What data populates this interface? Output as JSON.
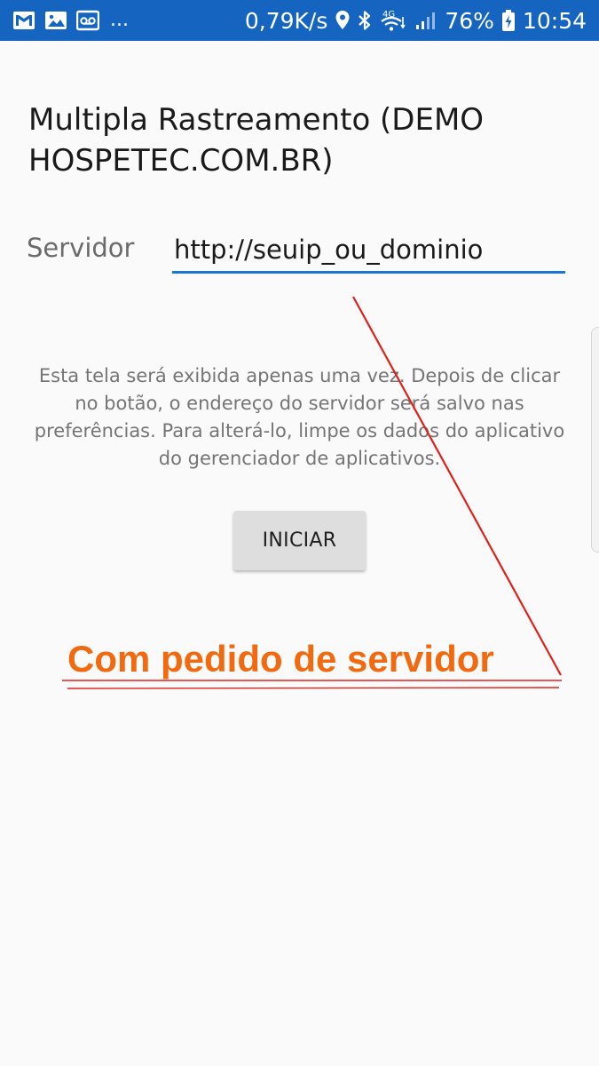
{
  "status_bar": {
    "notifications": [
      "gmail-icon",
      "image-icon",
      "voicemail-icon"
    ],
    "more_indicator": "...",
    "network_speed": "0,79K/s",
    "network_type": "4G",
    "battery_percent": "76%",
    "time": "10:54",
    "background_color": "#1565c0"
  },
  "screen": {
    "title": "Multipla Rastreamento (DEMO HOSPETEC.COM.BR)",
    "server_label": "Servidor",
    "server_value": "http://seuip_ou_dominio",
    "info_text": "Esta tela será exibida apenas uma vez. Depois de clicar no botão, o endereço do servidor será salvo nas preferências. Para alterá-lo, limpe os dados do aplicativo do gerenciador de aplicativos.",
    "start_button": "INICIAR",
    "accent_color": "#1976d2"
  },
  "annotation": {
    "text": "Com pedido de servidor",
    "text_color": "#f26a0f",
    "line_color": "#e0201a"
  }
}
